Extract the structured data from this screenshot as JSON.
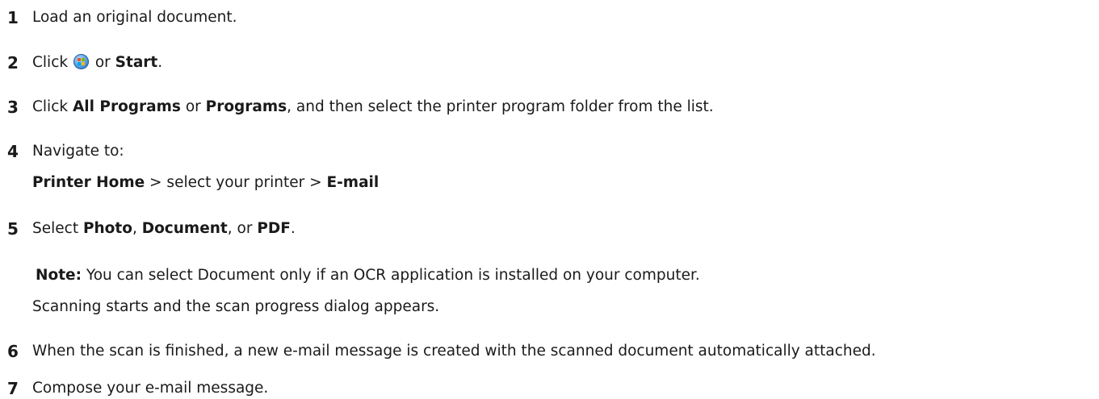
{
  "steps": [
    {
      "num": "1",
      "text": "Load an original document."
    },
    {
      "num": "2",
      "pre": "Click ",
      "icon": "windows-start-orb-icon",
      "mid": " or ",
      "bold": "Start",
      "post": "."
    },
    {
      "num": "3",
      "pre": "Click ",
      "bold1": "All Programs",
      "mid": " or ",
      "bold2": "Programs",
      "post": ", and then select the printer program folder from the list."
    },
    {
      "num": "4",
      "text": "Navigate to:",
      "path_bold1": "Printer Home",
      "path_mid": " > select your printer > ",
      "path_bold2": "E-mail"
    },
    {
      "num": "5",
      "pre": "Select ",
      "bold1": "Photo",
      "sep1": ", ",
      "bold2": "Document",
      "sep2": ", or ",
      "bold3": "PDF",
      "post": ".",
      "note_label": "Note:",
      "note_text": " You can select Document only if an OCR application is installed on your computer.",
      "result": "Scanning starts and the scan progress dialog appears."
    },
    {
      "num": "6",
      "text": "When the scan is finished, a new e-mail message is created with the scanned document automatically attached."
    },
    {
      "num": "7",
      "text": "Compose your e-mail message."
    }
  ]
}
